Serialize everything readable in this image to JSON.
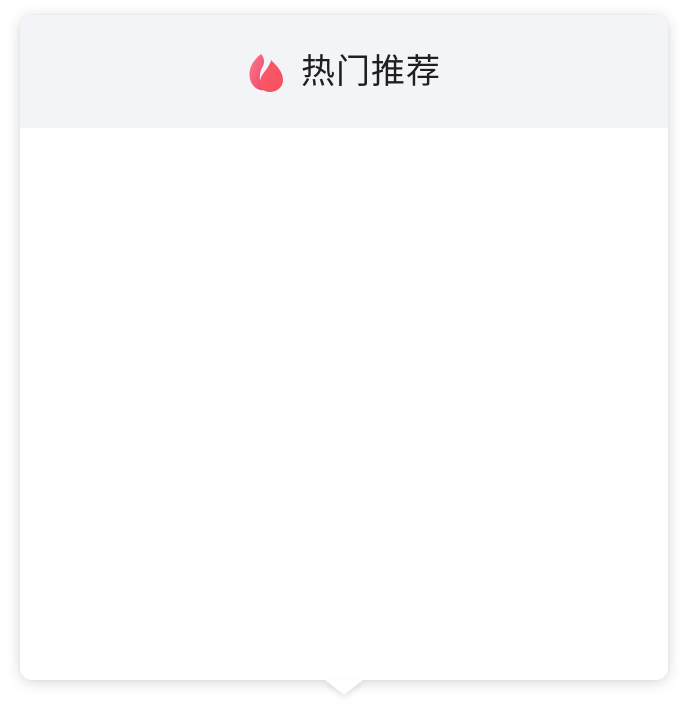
{
  "popover": {
    "title": "热门推荐",
    "icon": "flame-icon"
  },
  "colors": {
    "header_bg": "#f3f4f7",
    "flame_primary": "#f2505f",
    "flame_secondary": "#e8456f"
  }
}
